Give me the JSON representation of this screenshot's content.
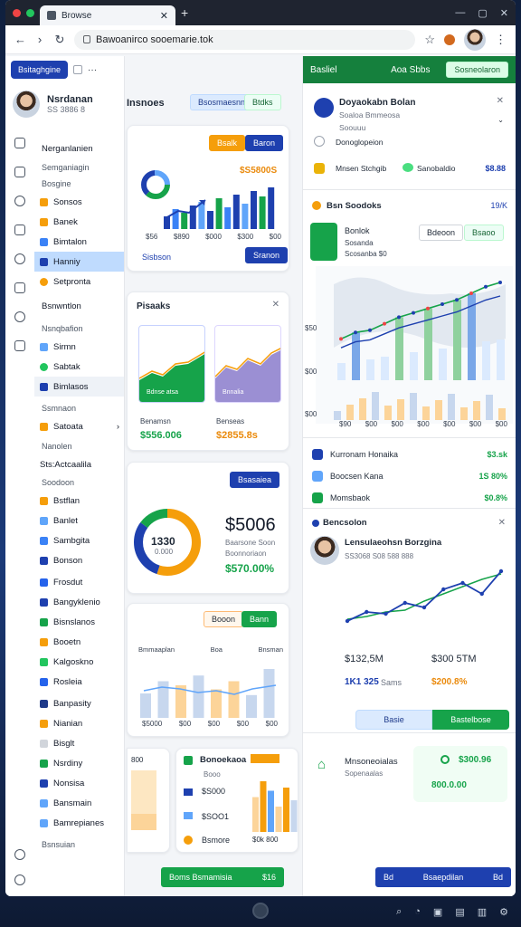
{
  "browser": {
    "tab_title": "Browse",
    "url": "Bawoanirco sooemarie.tok",
    "colors": {
      "chrome": "#1f2430",
      "accent_green": "#16a34a",
      "accent_blue": "#1e40af",
      "accent_orange": "#f59e0b"
    }
  },
  "sidebar": {
    "workspace_pill": "Bsitaghgine",
    "user_name": "Nsrdanan",
    "user_sub": "SS 3886 8",
    "section_1": "Nerganlanien",
    "section_1_sub": "Semganiagin",
    "section_1_sub2": "Bosgine",
    "items_a": [
      {
        "label": "Sonsos",
        "icon": "star-icon"
      },
      {
        "label": "Banek",
        "icon": "box-icon"
      },
      {
        "label": "Bimtalon",
        "icon": "grid-icon"
      },
      {
        "label": "Hanniy",
        "icon": "doc-icon"
      },
      {
        "label": "Setpronta",
        "icon": "coin-icon"
      }
    ],
    "section_2": "Bsnwntlon",
    "section_2_sub": "Nsnqbafion",
    "items_b": [
      {
        "label": "Sirmn",
        "icon": "chart-icon"
      },
      {
        "label": "Sabtak",
        "icon": "cloud-icon"
      },
      {
        "label": "Bimlasos",
        "icon": "doc-icon"
      }
    ],
    "section_3": "Ssmnaon",
    "item_c": "Satoata",
    "section_4": "Nanolen",
    "section_4_sub": "Sts:Actcaalila",
    "section_5": "Soodoon",
    "items_d": [
      {
        "label": "Bstflan",
        "icon": "box-icon"
      },
      {
        "label": "Banlet",
        "icon": "grid-icon"
      },
      {
        "label": "Sambgita",
        "icon": "chart-icon"
      },
      {
        "label": "Bonson",
        "icon": "doc-icon"
      },
      {
        "label": "Frosdut",
        "icon": "doc-icon"
      },
      {
        "label": "Bangyklenio",
        "icon": "doc-icon"
      },
      {
        "label": "Bisnslanos",
        "icon": "leaf-icon"
      },
      {
        "label": "Booetn",
        "icon": "cloud-icon"
      },
      {
        "label": "Kalgoskno",
        "icon": "chart-icon"
      },
      {
        "label": "Rosleia",
        "icon": "thumb-icon"
      },
      {
        "label": "Banpasity",
        "icon": "doc-icon"
      },
      {
        "label": "Nianian",
        "icon": "chart-icon"
      },
      {
        "label": "Bisglt",
        "icon": "grid-icon"
      },
      {
        "label": "Nsrdiny",
        "icon": "doc-icon"
      },
      {
        "label": "Nonsisa",
        "icon": "link-icon"
      },
      {
        "label": "Bansmain",
        "icon": "cloud-icon"
      },
      {
        "label": "Bamrepianes",
        "icon": "cloud-icon"
      }
    ],
    "footer": "Bsnsuian"
  },
  "main": {
    "header_title": "Insnoes",
    "header_btn_1": "Bsosmaesnne",
    "header_btn_2": "Btdks",
    "card1": {
      "btn_orange": "Bsalk",
      "btn_blue": "Baron",
      "value": "$S5800S",
      "ticks": [
        "$56",
        "$890",
        "$000",
        "$300",
        "$00"
      ],
      "btn_bottom": "Sranon",
      "link": "Sisbson"
    },
    "card2": {
      "title": "Pisaaks",
      "tile1_label": "Bdnse atsa",
      "tile2_label": "Bnnalia",
      "tile1_caption": "Benamsn",
      "tile2_caption": "Benseas",
      "tile1_value": "$556.006",
      "tile2_value": "$2855.8s"
    },
    "card3": {
      "btn": "Bsasaiea",
      "donut_value": "1330",
      "donut_sub": "0.000",
      "big_value": "$5006",
      "sub1": "Baarsone Soon",
      "sub2": "Boonnoriaon",
      "green_value": "$570.00%",
      "donut_pct": [
        55,
        30,
        15
      ]
    },
    "card4": {
      "btn_1": "Booon",
      "btn_2": "Bann",
      "col_labels": [
        "Bmmaaplan",
        "Boa",
        "Bnsman"
      ],
      "ticks": [
        "$5000",
        "$00",
        "$00",
        "$00",
        "$00"
      ],
      "bars": [
        30,
        45,
        40,
        52,
        35,
        45,
        28,
        60
      ]
    },
    "card5": {
      "value_label": "800",
      "bars": [
        60,
        40,
        70,
        30
      ]
    },
    "card6": {
      "title": "Bonoekaoa",
      "sub": "Booo",
      "row1": "$S000",
      "row2": "$SOO1",
      "row3": "Bsmore",
      "tick": "$0k 800",
      "bars": [
        55,
        80,
        65,
        40,
        70,
        50
      ]
    },
    "bottom_btn": "Boms  Bsmamisia",
    "bottom_btn_right": "$16"
  },
  "right": {
    "header_label": "Basliel",
    "header_mid": "Aoa Sbbs",
    "header_btn": "Sosneolaron",
    "notice_title": "Doyaokabn Bolan",
    "notice_sub": "Soaloa Bmmeosa",
    "notice_line": "Soouuu",
    "notice_line2": "Donoglopeion",
    "notice_row_label": "Mnsen Stchgib",
    "notice_row_sub": "Sanobaldio",
    "notice_row_value": "$8.88",
    "section_title": "Bsn Soodoks",
    "section_value": "19/K",
    "map_title": "Bonlok",
    "map_sub1": "Sosanda",
    "map_sub2": "Scosanba $0",
    "map_btn_1": "Bdeoon",
    "map_btn_2": "Bsaoo",
    "map_ticks_y": [
      "$50",
      "$00",
      "$00"
    ],
    "map_ticks_x": [
      "$90",
      "$00",
      "$00",
      "$00",
      "$00",
      "$00",
      "$00"
    ],
    "line_values": [
      38,
      44,
      46,
      52,
      58,
      62,
      66,
      70,
      74,
      80,
      86,
      90
    ],
    "list_rows": [
      {
        "label": "Kurronam Honaika",
        "value": "$3.sk"
      },
      {
        "label": "Boocsen Kana",
        "value": "1S 80%"
      },
      {
        "label": "Momsbaok",
        "value": "$0.8%"
      }
    ],
    "bencsolon": "Bencsolon",
    "person_name": "Lensulaeohsn Borzgina",
    "person_sub": "SS3068 S08 588 888",
    "trend_values": [
      20,
      30,
      28,
      40,
      35,
      55,
      62,
      50,
      75
    ],
    "trend_values_2": [
      22,
      25,
      30,
      32,
      42,
      50,
      58,
      66,
      72
    ],
    "stats": [
      "$132,5M",
      "$300 5TM"
    ],
    "stat_sub_1": "1K1 325",
    "stat_sub_1b": "Sams",
    "stat_sub_2": "$200.8%",
    "toggle_1": "Basie",
    "toggle_2": "Bastelbose",
    "footer_title": "Mnsoneoialas",
    "footer_sub": "Sopenaalas",
    "footer_value": "$300.96",
    "footer_value2": "800.0.00",
    "bottom_btn_left": "Bd",
    "bottom_btn_mid": "Bsaepdilan",
    "bottom_btn_right": "Bd"
  },
  "taskbar": {
    "icons": [
      "search-icon",
      "chat-icon",
      "window-icon",
      "image-icon",
      "folder-icon",
      "settings-icon"
    ]
  }
}
